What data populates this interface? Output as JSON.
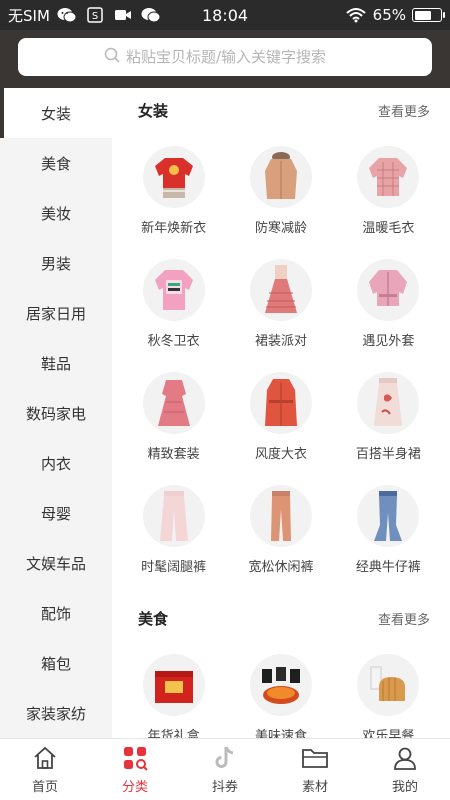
{
  "status_bar": {
    "carrier": "无SIM",
    "time": "18:04",
    "battery_percent": "65%",
    "battery_level": 0.65,
    "left_icons": [
      "wechat-icon",
      "s-app-icon",
      "video-icon",
      "chat-icon"
    ]
  },
  "search": {
    "placeholder": "粘贴宝贝标题/输入关键字搜索"
  },
  "sidebar": {
    "items": [
      {
        "label": "女装"
      },
      {
        "label": "美食"
      },
      {
        "label": "美妆"
      },
      {
        "label": "男装"
      },
      {
        "label": "居家日用"
      },
      {
        "label": "鞋品"
      },
      {
        "label": "数码家电"
      },
      {
        "label": "内衣"
      },
      {
        "label": "母婴"
      },
      {
        "label": "文娱车品"
      },
      {
        "label": "配饰"
      },
      {
        "label": "箱包"
      },
      {
        "label": "家装家纺"
      }
    ],
    "active_index": 0
  },
  "sections": [
    {
      "title": "女装",
      "more": "查看更多",
      "items": [
        {
          "label": "新年焕新衣",
          "icon": "red-sweater-icon"
        },
        {
          "label": "防寒减龄",
          "icon": "coat-icon"
        },
        {
          "label": "温暖毛衣",
          "icon": "knit-sweater-icon"
        },
        {
          "label": "秋冬卫衣",
          "icon": "hoodie-icon"
        },
        {
          "label": "裙装派对",
          "icon": "dress-icon"
        },
        {
          "label": "遇见外套",
          "icon": "jacket-icon"
        },
        {
          "label": "精致套装",
          "icon": "suit-dress-icon"
        },
        {
          "label": "风度大衣",
          "icon": "overcoat-icon"
        },
        {
          "label": "百搭半身裙",
          "icon": "skirt-icon"
        },
        {
          "label": "时髦阔腿裤",
          "icon": "wide-pants-icon"
        },
        {
          "label": "宽松休闲裤",
          "icon": "casual-pants-icon"
        },
        {
          "label": "经典牛仔裤",
          "icon": "jeans-icon"
        }
      ]
    },
    {
      "title": "美食",
      "more": "查看更多",
      "items": [
        {
          "label": "年货礼盒",
          "icon": "gift-box-icon"
        },
        {
          "label": "美味速食",
          "icon": "instant-food-icon"
        },
        {
          "label": "欢乐早餐",
          "icon": "bread-milk-icon"
        }
      ]
    }
  ],
  "tabbar": {
    "items": [
      {
        "label": "首页",
        "icon": "home-icon"
      },
      {
        "label": "分类",
        "icon": "category-icon"
      },
      {
        "label": "抖券",
        "icon": "tiktok-icon"
      },
      {
        "label": "素材",
        "icon": "folder-icon"
      },
      {
        "label": "我的",
        "icon": "user-icon"
      }
    ],
    "active_index": 1
  },
  "colors": {
    "header_bg": "#3a3633",
    "accent": "#e8323b",
    "sidebar_bg": "#f4f4f4"
  }
}
